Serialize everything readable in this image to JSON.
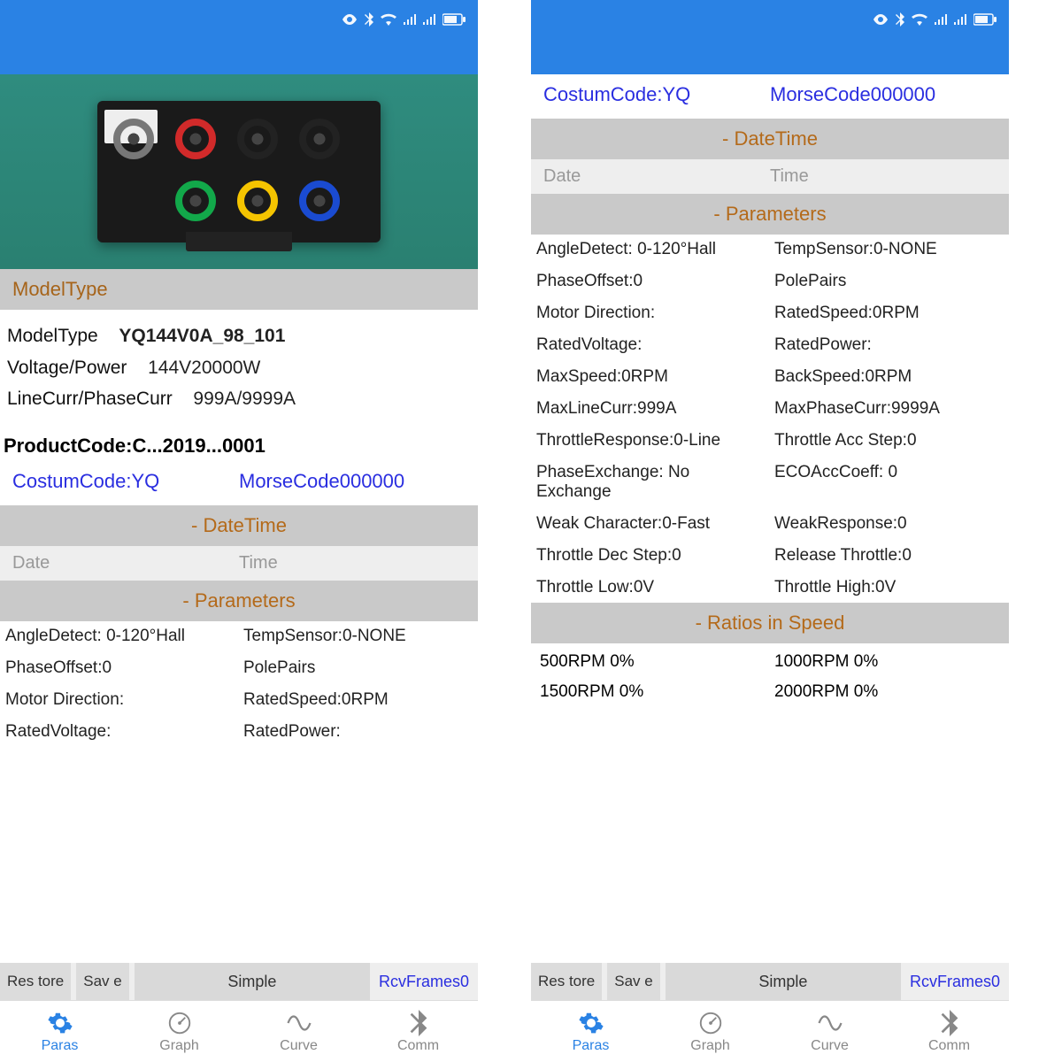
{
  "status_icons": [
    "eye",
    "bluetooth",
    "wifi",
    "signal1",
    "signal2",
    "battery"
  ],
  "left": {
    "modeltype_header": "ModelType",
    "info": {
      "model_label": "ModelType",
      "model_value": "YQ144V0A_98_101",
      "volt_label": "Voltage/Power",
      "volt_value": "144V20000W",
      "curr_label": "LineCurr/PhaseCurr",
      "curr_value": "999A/9999A"
    },
    "product_code": "ProductCode:C...2019...0001",
    "codes": {
      "custom": "CostumCode:YQ",
      "morse": "MorseCode000000"
    },
    "datetime_header": "- DateTime",
    "date_label": "Date",
    "time_label": "Time",
    "parameters_header": "- Parameters",
    "params": [
      "AngleDetect: 0-120°Hall",
      "TempSensor:0-NONE",
      "PhaseOffset:0",
      "PolePairs",
      "Motor Direction:",
      "RatedSpeed:0RPM",
      "RatedVoltage:",
      "RatedPower:"
    ],
    "toolbar": {
      "restore": "Res\ntore",
      "save": "Sav\ne",
      "simple": "Simple",
      "rcv": "RcvFrames0"
    }
  },
  "right": {
    "codes": {
      "custom": "CostumCode:YQ",
      "morse": "MorseCode000000"
    },
    "datetime_header": "- DateTime",
    "date_label": "Date",
    "time_label": "Time",
    "parameters_header": "- Parameters",
    "params": [
      "AngleDetect: 0-120°Hall",
      "TempSensor:0-NONE",
      "PhaseOffset:0",
      "PolePairs",
      "Motor Direction:",
      "RatedSpeed:0RPM",
      "RatedVoltage:",
      "RatedPower:",
      "MaxSpeed:0RPM",
      "BackSpeed:0RPM",
      "MaxLineCurr:999A",
      "MaxPhaseCurr:9999A",
      "ThrottleResponse:0-Line",
      "Throttle Acc Step:0",
      "PhaseExchange:  No Exchange",
      "ECOAccCoeff:  0",
      "Weak Character:0-Fast",
      "WeakResponse:0",
      "Throttle Dec Step:0",
      "Release Throttle:0",
      "Throttle Low:0V",
      "Throttle High:0V"
    ],
    "ratios_header": "- Ratios in Speed",
    "ratios": [
      "500RPM   0%",
      "1000RPM   0%",
      "1500RPM   0%",
      "2000RPM   0%"
    ],
    "toolbar": {
      "restore": "Res\ntore",
      "save": "Sav\ne",
      "simple": "Simple",
      "rcv": "RcvFrames0"
    }
  },
  "nav": {
    "paras": "Paras",
    "graph": "Graph",
    "curve": "Curve",
    "comm": "Comm"
  }
}
